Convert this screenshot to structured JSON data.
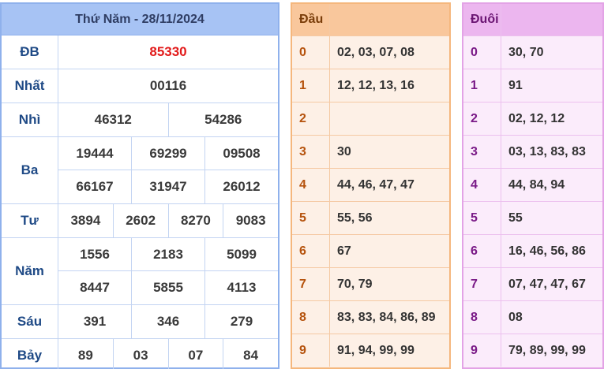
{
  "title": "Thứ Năm - 28/11/2024",
  "prizes": [
    {
      "label": "ĐB",
      "rows": [
        [
          "85330"
        ]
      ]
    },
    {
      "label": "Nhất",
      "rows": [
        [
          "00116"
        ]
      ]
    },
    {
      "label": "Nhì",
      "rows": [
        [
          "46312",
          "54286"
        ]
      ]
    },
    {
      "label": "Ba",
      "rows": [
        [
          "19444",
          "69299",
          "09508"
        ],
        [
          "66167",
          "31947",
          "26012"
        ]
      ]
    },
    {
      "label": "Tư",
      "rows": [
        [
          "3894",
          "2602",
          "8270",
          "9083"
        ]
      ]
    },
    {
      "label": "Năm",
      "rows": [
        [
          "1556",
          "2183",
          "5099"
        ],
        [
          "8447",
          "5855",
          "4113"
        ]
      ]
    },
    {
      "label": "Sáu",
      "rows": [
        [
          "391",
          "346",
          "279"
        ]
      ]
    },
    {
      "label": "Bảy",
      "rows": [
        [
          "89",
          "03",
          "07",
          "84"
        ]
      ]
    }
  ],
  "special_color": "#e21b1b",
  "dau": {
    "header": "Đầu",
    "rows": [
      {
        "key": "0",
        "value": "02, 03, 07, 08"
      },
      {
        "key": "1",
        "value": "12, 12, 13, 16"
      },
      {
        "key": "2",
        "value": ""
      },
      {
        "key": "3",
        "value": "30"
      },
      {
        "key": "4",
        "value": "44, 46, 47, 47"
      },
      {
        "key": "5",
        "value": "55, 56"
      },
      {
        "key": "6",
        "value": "67"
      },
      {
        "key": "7",
        "value": "70, 79"
      },
      {
        "key": "8",
        "value": "83, 83, 84, 86, 89"
      },
      {
        "key": "9",
        "value": "91, 94, 99, 99"
      }
    ]
  },
  "duoi": {
    "header": "Đuôi",
    "rows": [
      {
        "key": "0",
        "value": "30, 70"
      },
      {
        "key": "1",
        "value": "91"
      },
      {
        "key": "2",
        "value": "02, 12, 12"
      },
      {
        "key": "3",
        "value": "03, 13, 83, 83"
      },
      {
        "key": "4",
        "value": "44, 84, 94"
      },
      {
        "key": "5",
        "value": "55"
      },
      {
        "key": "6",
        "value": "16, 46, 56, 86"
      },
      {
        "key": "7",
        "value": "07, 47, 47, 67"
      },
      {
        "key": "8",
        "value": "08"
      },
      {
        "key": "9",
        "value": "79, 89, 99, 99"
      }
    ]
  }
}
